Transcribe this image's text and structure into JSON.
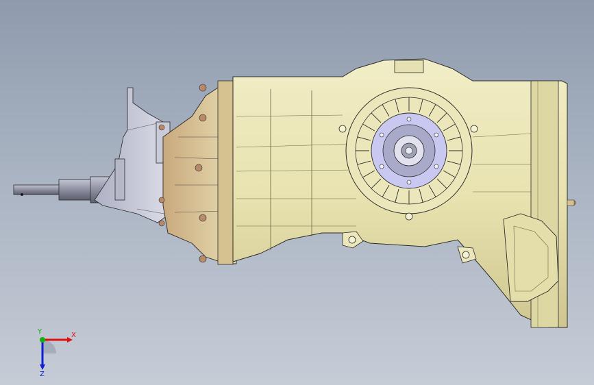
{
  "viewport": {
    "background_top": "#8f9bad",
    "background_bottom": "#c6ccd6"
  },
  "model": {
    "name_icon": "gearbox-transmission-model",
    "colors": {
      "housing": "#e8e3b0",
      "housing_shadow": "#b9b07a",
      "bellhousing": "#d9c79a",
      "bolt": "#b98a6a",
      "mount": "#c9cbd8",
      "shaft": "#8d8fa0",
      "flange": "#c9c8f0",
      "edge": "#2a2a2a"
    }
  },
  "triad": {
    "x_label": "X",
    "y_label": "Y",
    "z_label": "Z",
    "colors": {
      "x": "#e01010",
      "y": "#10b010",
      "z": "#1020d0"
    }
  }
}
